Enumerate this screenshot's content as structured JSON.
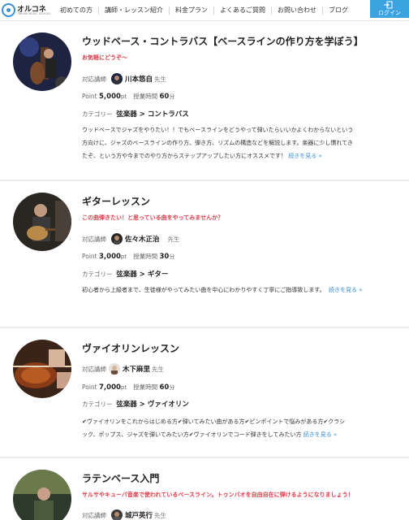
{
  "header": {
    "logo_text": "オルコネ",
    "logo_sub": "ONLINE MUSIC SCHOOL",
    "nav": [
      "初めての方",
      "講師・レッスン紹介",
      "料金プラン",
      "よくあるご質問",
      "お問い合わせ",
      "ブログ"
    ],
    "login_label": "ログイン",
    "colors": {
      "accent": "#3aa3e0",
      "catch": "#e03a4a",
      "link": "#3a8fd6"
    }
  },
  "labels": {
    "teacher": "対応講師",
    "sensei": "先生",
    "point": "Point",
    "pt": "pt",
    "time": "授業時間",
    "minutes": "分",
    "category": "カテゴリー",
    "more": "続きを見る »"
  },
  "lessons": [
    {
      "title": "ウッドベース・コントラバス【ベースラインの作り方を学ぼう】",
      "catch": "お気軽にどうぞ〜",
      "teacher": "川本悠自",
      "point": "5,000",
      "minutes": "60",
      "category": "弦楽器 > コントラバス",
      "desc": [
        "ウッドベースでジャズをやりたい！！でもベースラインをどうやって弾いたらいいかよくわからないという",
        "方向けに、ジャズのベースラインの作り方、弾き方、リズムの構造などを解説します。楽器に少し慣れてき",
        "たぞ、という方や今までのやり方からステップアップしたい方にオススメです！"
      ]
    },
    {
      "title": "ギターレッスン",
      "catch": "この曲弾きたい！と思っている曲をやってみませんか？",
      "teacher": "佐々木正治",
      "point": "3,000",
      "minutes": "30",
      "category": "弦楽器 > ギター",
      "desc": [
        "初心者から上級者まで、生徒様がやってみたい曲を中心にわかりやすく丁寧にご指導致します。"
      ]
    },
    {
      "title": "ヴァイオリンレッスン",
      "catch": "",
      "teacher": "木下麻里",
      "point": "7,000",
      "minutes": "60",
      "category": "弦楽器 > ヴァイオリン",
      "desc": [
        "✔ヴァイオリンをこれからはじめる方✔弾いてみたい曲がある方✔ピンポイントで悩みがある方✔クラシ",
        "ック、ポップス、ジャズを弾いてみたい方✔ヴァイオリンでコード弾きをしてみたい方"
      ]
    },
    {
      "title": "ラテンベース入門",
      "catch": "サルサやキューバ音楽で使われているベースライン。トゥンバオを自由自在に弾けるようになりましょう！",
      "teacher": "城戸英行",
      "point": "",
      "minutes": "",
      "category": "",
      "desc": []
    }
  ]
}
